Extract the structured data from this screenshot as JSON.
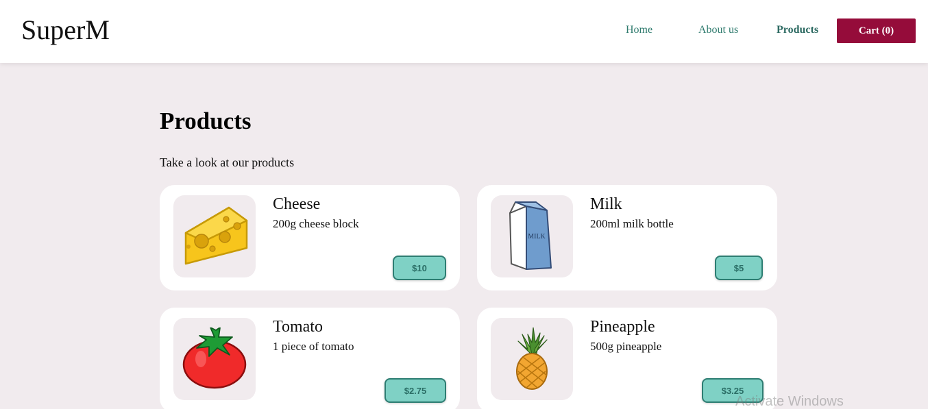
{
  "navbar": {
    "brand": "SuperM",
    "links": [
      "Home",
      "About us",
      "Products"
    ],
    "cart_label": "Cart (0)"
  },
  "page": {
    "title": "Products",
    "subtitle": "Take a look at our products"
  },
  "products": [
    {
      "name": "Cheese",
      "description": "200g cheese block",
      "price": "$10",
      "icon": "cheese-icon"
    },
    {
      "name": "Milk",
      "description": "200ml milk bottle",
      "price": "$5",
      "icon": "milk-icon",
      "icon_label": "MILK"
    },
    {
      "name": "Tomato",
      "description": "1 piece of tomato",
      "price": "$2.75",
      "icon": "tomato-icon"
    },
    {
      "name": "Pineapple",
      "description": "500g pineapple",
      "price": "$3.25",
      "icon": "pineapple-icon"
    }
  ],
  "os": {
    "watermark": "Activate Windows"
  },
  "colors": {
    "background": "#f1ebee",
    "accent_teal": "#7fd1c5",
    "cart_button": "#950c3a",
    "nav_link": "#2f7b6e"
  }
}
